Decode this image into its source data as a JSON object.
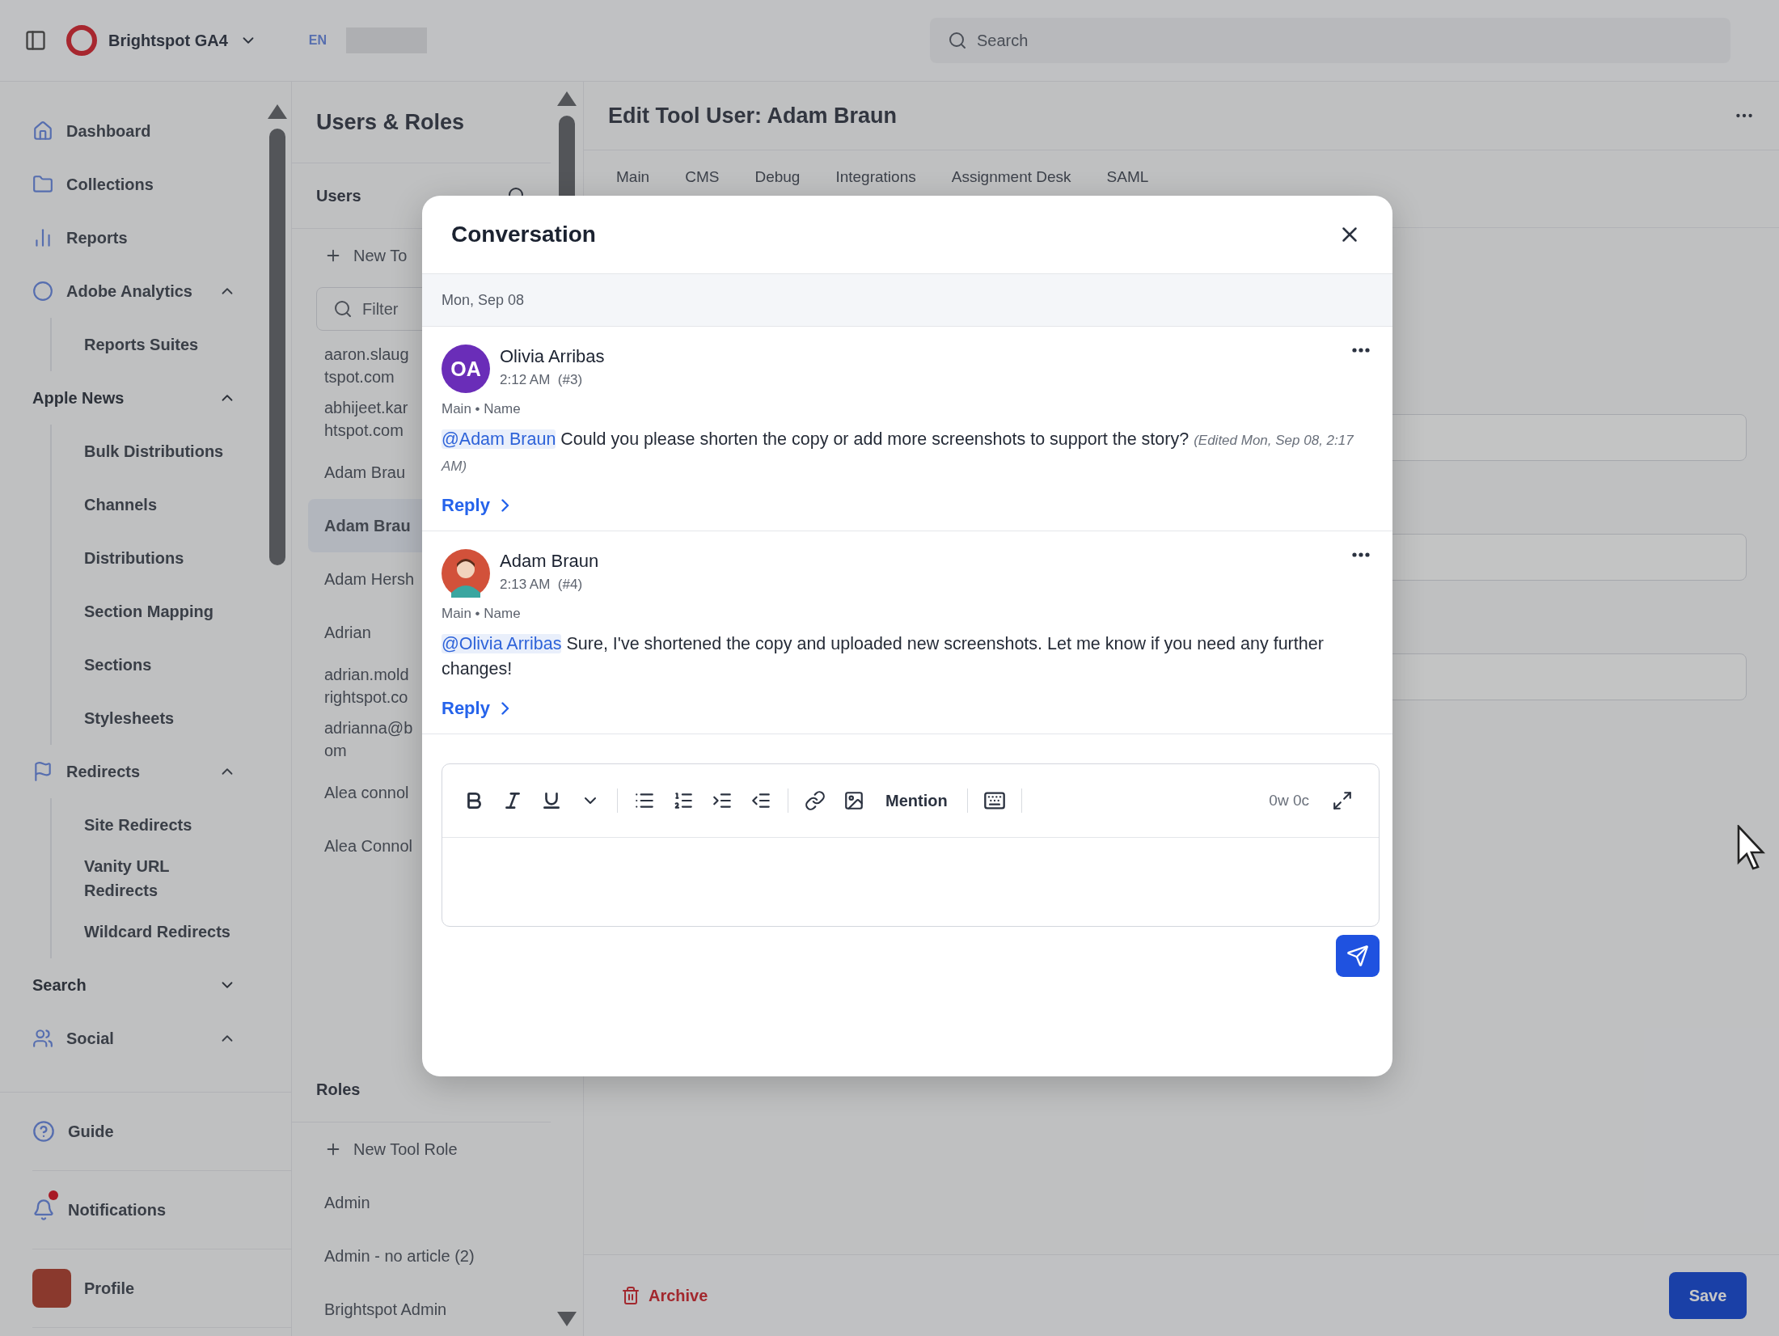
{
  "topbar": {
    "site": "Brightspot GA4",
    "locale": "EN",
    "search_placeholder": "Search"
  },
  "sidebar": {
    "entries": [
      {
        "kind": "link",
        "label": "Dashboard"
      },
      {
        "kind": "link",
        "label": "Collections"
      },
      {
        "kind": "link",
        "label": "Reports"
      },
      {
        "kind": "section",
        "label": "Adobe Analytics",
        "expanded": true,
        "children": [
          {
            "label": "Reports Suites"
          }
        ]
      },
      {
        "kind": "section",
        "label": "Apple News",
        "expanded": true,
        "children": [
          {
            "label": "Bulk Distributions"
          },
          {
            "label": "Channels"
          },
          {
            "label": "Distributions"
          },
          {
            "label": "Section Mapping"
          },
          {
            "label": "Sections"
          },
          {
            "label": "Stylesheets"
          }
        ]
      },
      {
        "kind": "section",
        "label": "Redirects",
        "expanded": true,
        "children": [
          {
            "label": "Site Redirects"
          },
          {
            "label": "Vanity URL Redirects"
          },
          {
            "label": "Wildcard Redirects"
          }
        ]
      },
      {
        "kind": "section",
        "label": "Search",
        "expanded": false
      },
      {
        "kind": "section",
        "label": "Social",
        "expanded": true
      }
    ],
    "footer": [
      {
        "kind": "guide",
        "label": "Guide"
      },
      {
        "kind": "notifications",
        "label": "Notifications",
        "alert": true
      },
      {
        "kind": "profile",
        "label": "Profile"
      }
    ]
  },
  "users_panel": {
    "title": "Users & Roles",
    "users_heading": "Users",
    "new_user": "New To",
    "filter_placeholder": "Filter",
    "users": [
      {
        "lines": [
          "aaron.slaug",
          "tspot.com"
        ],
        "selected": false
      },
      {
        "lines": [
          "abhijeet.kar",
          "htspot.com"
        ],
        "selected": false
      },
      {
        "lines": [
          "Adam Brau"
        ],
        "selected": false
      },
      {
        "lines": [
          "Adam Brau"
        ],
        "selected": true
      },
      {
        "lines": [
          "Adam Hersh"
        ],
        "selected": false
      },
      {
        "lines": [
          "Adrian"
        ],
        "selected": false
      },
      {
        "lines": [
          "adrian.mold",
          "rightspot.co"
        ],
        "selected": false
      },
      {
        "lines": [
          "adrianna@b",
          "om"
        ],
        "selected": false
      },
      {
        "lines": [
          "Alea connol"
        ],
        "selected": false
      },
      {
        "lines": [
          "Alea Connol"
        ],
        "selected": false
      }
    ],
    "roles_heading": "Roles",
    "new_role": "New Tool Role",
    "roles": [
      "Admin",
      "Admin - no article (2)",
      "Brightspot Admin"
    ]
  },
  "editor": {
    "title": "Edit Tool User: Adam Braun",
    "tabs": [
      "Main",
      "CMS",
      "Debug",
      "Integrations",
      "Assignment Desk",
      "SAML"
    ],
    "archive": "Archive",
    "save": "Save"
  },
  "conversation": {
    "title": "Conversation",
    "date": "Mon, Sep 08",
    "comments": [
      {
        "author": "Olivia Arribas",
        "kind": "initials",
        "initials": "OA",
        "color": "#6a2db8",
        "time": "2:12 AM",
        "number": "(#3)",
        "context": "Main • Name",
        "mention": "@Adam Braun",
        "text": "Could you please shorten the copy or add more screenshots to support the story?",
        "edited": "(Edited Mon, Sep 08, 2:17 AM)",
        "reply": "Reply"
      },
      {
        "author": "Adam Braun",
        "kind": "image",
        "time": "2:13 AM",
        "number": "(#4)",
        "context": "Main • Name",
        "mention": "@Olivia Arribas",
        "text": "Sure, I've shortened the copy and uploaded new screenshots. Let me know if you need any further changes!",
        "reply": "Reply"
      }
    ],
    "composer": {
      "mention": "Mention",
      "counter": "0w 0c"
    }
  }
}
